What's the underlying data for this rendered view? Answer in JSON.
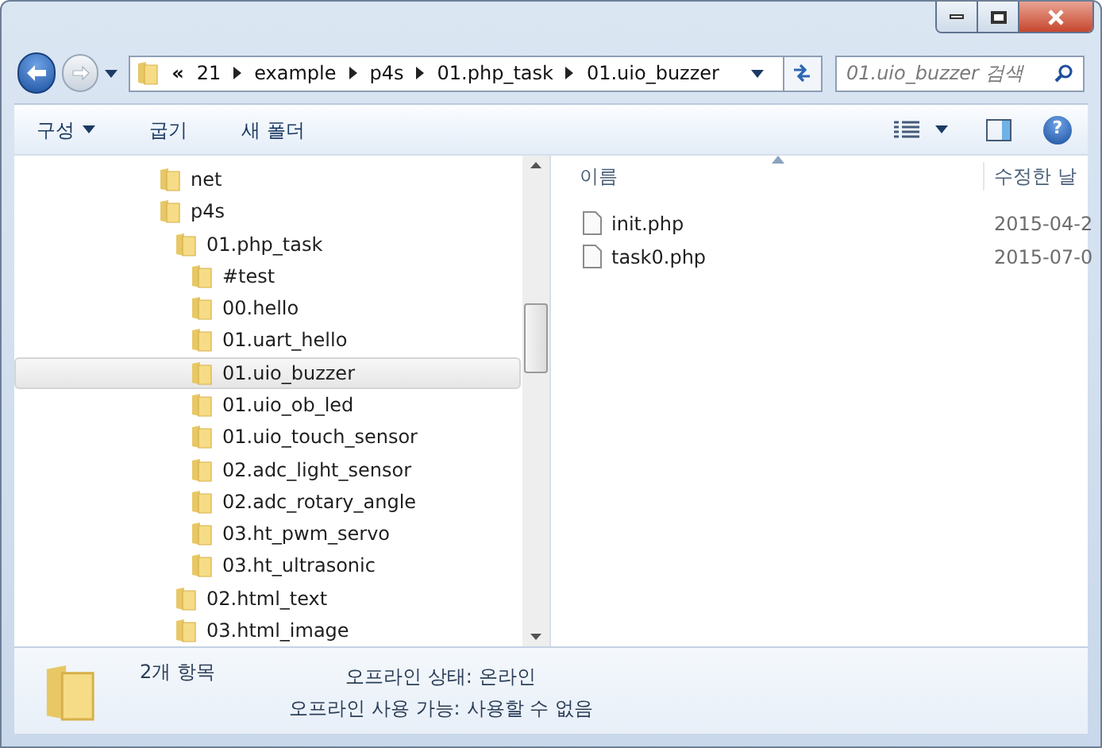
{
  "address": {
    "overflow": "«",
    "segments": [
      "21",
      "example",
      "p4s",
      "01.php_task",
      "01.uio_buzzer"
    ]
  },
  "search": {
    "placeholder": "01.uio_buzzer 검색"
  },
  "toolbar": {
    "organize": "구성",
    "burn": "굽기",
    "new_folder": "새 폴더",
    "help": "?"
  },
  "tree": [
    {
      "label": "net",
      "selected": false
    },
    {
      "label": "p4s",
      "selected": false,
      "children": [
        {
          "label": "01.php_task",
          "selected": false,
          "children": [
            {
              "label": "#test",
              "selected": false
            },
            {
              "label": "00.hello",
              "selected": false
            },
            {
              "label": "01.uart_hello",
              "selected": false
            },
            {
              "label": "01.uio_buzzer",
              "selected": true
            },
            {
              "label": "01.uio_ob_led",
              "selected": false
            },
            {
              "label": "01.uio_touch_sensor",
              "selected": false
            },
            {
              "label": "02.adc_light_sensor",
              "selected": false
            },
            {
              "label": "02.adc_rotary_angle",
              "selected": false
            },
            {
              "label": "03.ht_pwm_servo",
              "selected": false
            },
            {
              "label": "03.ht_ultrasonic",
              "selected": false
            }
          ]
        },
        {
          "label": "02.html_text",
          "selected": false
        },
        {
          "label": "03.html_image",
          "selected": false
        }
      ]
    }
  ],
  "columns": [
    "이름",
    "수정한 날"
  ],
  "files": [
    {
      "name": "init.php",
      "modified": "2015-04-2"
    },
    {
      "name": "task0.php",
      "modified": "2015-07-0"
    }
  ],
  "details": {
    "count": "2개 항목",
    "lines": [
      {
        "label": "오프라인 상태:",
        "value": "온라인"
      },
      {
        "label": "오프라인 사용 가능:",
        "value": "사용할 수 없음"
      }
    ]
  }
}
